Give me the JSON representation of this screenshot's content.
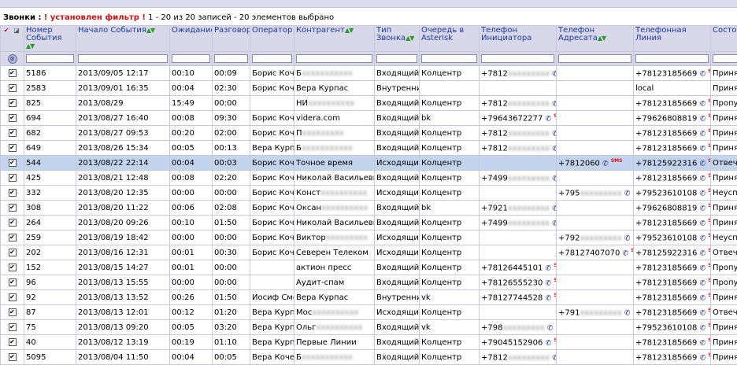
{
  "status": {
    "label": "Звонки :",
    "filter_flag": "! установлен фильтр !",
    "summary": "1 - 20 из 20 записей - 20 элементов выбрано"
  },
  "columns": [
    "Номер События",
    "Начало События",
    "Ожидание",
    "Разговор",
    "Оператор",
    "Контрагент",
    "Тип Звонка",
    "Очередь в Asterisk",
    "Телефон Инициатора",
    "Телефон Адресата",
    "Телефонная Линия",
    "Состояние"
  ],
  "header_icons": {
    "a": "✔",
    "b": "◪",
    "gear": "⚙"
  },
  "phone_icon": "✆",
  "sms_icon": "SMS",
  "check_mark": "✔",
  "rows": [
    {
      "id": "5186",
      "start": "2013/09/05 12:17",
      "wait": "00:10",
      "talk": "00:09",
      "oper": "Борис Кочеров",
      "contr": "Б",
      "contr_b": "xxxxxxxxxxx",
      "type": "Входящий",
      "queue": "Колцентр",
      "init": "+7812",
      "init_b": "xxxxxxxxx",
      "dest": "",
      "dest_b": "",
      "line": "+78123185669",
      "state": "Принят",
      "sel": false
    },
    {
      "id": "2583",
      "start": "2013/09/01 16:35",
      "wait": "00:04",
      "talk": "02:30",
      "oper": "Борис Кочеров",
      "contr": "Вера Курпас",
      "contr_b": "",
      "type": "Внутренний",
      "queue": "",
      "init": "",
      "init_b": "",
      "dest": "",
      "dest_b": "",
      "line": "local",
      "state": "Принят",
      "sel": false
    },
    {
      "id": "825",
      "start": "2013/08/29",
      "wait": "15:49",
      "talk": "00:00",
      "oper": "",
      "contr": "НИ",
      "contr_b": "xxxxxxxxxx",
      "type": "Входящий",
      "queue": "Колцентр",
      "init": "+7812",
      "init_b": "xxxxxxxxx",
      "dest": "",
      "dest_b": "",
      "line": "+78123185669",
      "state": "Пропущен",
      "sel": false
    },
    {
      "id": "694",
      "start": "2013/08/27 16:40",
      "wait": "00:08",
      "talk": "09:30",
      "oper": "Борис Кочеров",
      "contr": "videra.com",
      "contr_b": "",
      "type": "Входящий",
      "queue": "bk",
      "init": "+79643672277",
      "init_b": "",
      "dest": "",
      "dest_b": "",
      "line": "+79626808819",
      "state": "Принят",
      "sel": false
    },
    {
      "id": "682",
      "start": "2013/08/27 09:53",
      "wait": "00:20",
      "talk": "02:00",
      "oper": "Борис Кочеров",
      "contr": "П",
      "contr_b": "xxxxxxxxx",
      "type": "Входящий",
      "queue": "Колцентр",
      "init": "+7812",
      "init_b": "xxxxxxxxx",
      "dest": "",
      "dest_b": "",
      "line": "+78123185669",
      "state": "Принят",
      "sel": false
    },
    {
      "id": "649",
      "start": "2013/08/26 15:34",
      "wait": "00:05",
      "talk": "00:13",
      "oper": "Вера Курпас",
      "contr": "Б",
      "contr_b": "xxxxxxxxxxx",
      "type": "Входящий",
      "queue": "Колцентр",
      "init": "+7812",
      "init_b": "xxxxxxxxx",
      "dest": "",
      "dest_b": "",
      "line": "+78123185669",
      "state": "Принят",
      "sel": false
    },
    {
      "id": "544",
      "start": "2013/08/22 22:14",
      "wait": "00:04",
      "talk": "00:03",
      "oper": "Борис Кочеров",
      "contr": "Точное время",
      "contr_b": "",
      "type": "Исходящий",
      "queue": "Колцентр",
      "init": "",
      "init_b": "",
      "dest": "+7812060",
      "dest_b": "",
      "line": "+78125922316",
      "state": "Отвеченный",
      "sel": true
    },
    {
      "id": "425",
      "start": "2013/08/21 12:48",
      "wait": "00:08",
      "talk": "02:20",
      "oper": "Борис Кочеров",
      "contr": "Николай Васильевич Дмитриев",
      "contr_b": "",
      "type": "Входящий",
      "queue": "Колцентр",
      "init": "+7499",
      "init_b": "xxxxxxxxx",
      "dest": "",
      "dest_b": "",
      "line": "+78123185669",
      "state": "Принят",
      "sel": false
    },
    {
      "id": "332",
      "start": "2013/08/20 12:35",
      "wait": "00:00",
      "talk": "00:00",
      "oper": "Борис Кочеров",
      "contr": "Конст",
      "contr_b": "xxxxxxxxxx",
      "type": "Исходящий",
      "queue": "Колцентр",
      "init": "",
      "init_b": "",
      "dest": "+795",
      "dest_b": "xxxxxxxxx",
      "line": "+79523610108",
      "state": "Неуспешный",
      "sel": false
    },
    {
      "id": "308",
      "start": "2013/08/20 11:22",
      "wait": "00:06",
      "talk": "02:08",
      "oper": "Борис Кочеров",
      "contr": "Оксан",
      "contr_b": "xxxxxxxxxx",
      "type": "Входящий",
      "queue": "bk",
      "init": "+7921",
      "init_b": "xxxxxxxxx",
      "dest": "",
      "dest_b": "",
      "line": "+79626808819",
      "state": "Принят",
      "sel": false
    },
    {
      "id": "264",
      "start": "2013/08/20 09:26",
      "wait": "00:10",
      "talk": "01:50",
      "oper": "Борис Кочеров",
      "contr": "Николай Васильевич Дмитриев",
      "contr_b": "",
      "type": "Входящий",
      "queue": "Колцентр",
      "init": "+7499",
      "init_b": "xxxxxxxxx",
      "dest": "",
      "dest_b": "",
      "line": "+78123185669",
      "state": "Принят",
      "sel": false
    },
    {
      "id": "259",
      "start": "2013/08/19 18:42",
      "wait": "00:00",
      "talk": "00:00",
      "oper": "Борис Кочеров",
      "contr": "Виктор",
      "contr_b": "xxxxxxxxx",
      "type": "Исходящий",
      "queue": "Колцентр",
      "init": "",
      "init_b": "",
      "dest": "+792",
      "dest_b": "xxxxxxxxx",
      "line": "+79523610108",
      "state": "Неуспешный",
      "sel": false
    },
    {
      "id": "202",
      "start": "2013/08/16 12:31",
      "wait": "00:01",
      "talk": "00:30",
      "oper": "Борис Кочеров",
      "contr": "Северен Телеком",
      "contr_b": "",
      "type": "Исходящий",
      "queue": "Колцентр",
      "init": "",
      "init_b": "",
      "dest": "+78127407070",
      "dest_b": "",
      "line": "+78125922316",
      "state": "Отвеченный",
      "sel": false
    },
    {
      "id": "152",
      "start": "2013/08/15 14:27",
      "wait": "00:01",
      "talk": "00:00",
      "oper": "",
      "contr": "актион пресс",
      "contr_b": "",
      "type": "Входящий",
      "queue": "Колцентр",
      "init": "+78126445101",
      "init_b": "",
      "dest": "",
      "dest_b": "",
      "line": "+78123185669",
      "state": "Пропущен",
      "sel": false
    },
    {
      "id": "96",
      "start": "2013/08/13 15:55",
      "wait": "00:00",
      "talk": "00:00",
      "oper": "",
      "contr": "Аудит-спам",
      "contr_b": "",
      "type": "Входящий",
      "queue": "Колцентр",
      "init": "+78126555230",
      "init_b": "",
      "dest": "",
      "dest_b": "",
      "line": "+78123185669",
      "state": "Пропущен",
      "sel": false
    },
    {
      "id": "92",
      "start": "2013/08/13 13:52",
      "wait": "00:26",
      "talk": "01:50",
      "oper": "Иосиф Смоткин",
      "contr": "Вера Курпас",
      "contr_b": "",
      "type": "Внутренний",
      "queue": "vk",
      "init": "+78127744528",
      "init_b": "",
      "dest": "",
      "dest_b": "",
      "line": "+78123185669",
      "state": "Принят",
      "sel": false
    },
    {
      "id": "87",
      "start": "2013/08/13 12:01",
      "wait": "00:12",
      "talk": "01:20",
      "oper": "Вера Курпас",
      "contr": "Мос",
      "contr_b": "xxxxxxxxxx",
      "type": "Исходящий",
      "queue": "Колцентр",
      "init": "",
      "init_b": "",
      "dest": "+791",
      "dest_b": "xxxxxxxxx",
      "line": "+78123185669",
      "state": "Отвеченный",
      "sel": false
    },
    {
      "id": "75",
      "start": "2013/08/13 09:20",
      "wait": "00:05",
      "talk": "03:20",
      "oper": "Вера Курпас",
      "contr": "Ольг",
      "contr_b": "xxxxxxxxxx",
      "type": "Входящий",
      "queue": "vk",
      "init": "+798",
      "init_b": "xxxxxxxxx",
      "dest": "",
      "dest_b": "",
      "line": "+79523610108",
      "state": "Принят",
      "sel": false
    },
    {
      "id": "40",
      "start": "2013/08/12 13:19",
      "wait": "00:19",
      "talk": "01:10",
      "oper": "Вера Курпас",
      "contr": "Первые Линии",
      "contr_b": "",
      "type": "Входящий",
      "queue": "Колцентр",
      "init": "+79045152906",
      "init_b": "",
      "dest": "",
      "dest_b": "",
      "line": "+78123185669",
      "state": "Принят",
      "sel": false
    },
    {
      "id": "5095",
      "start": "2013/08/04 11:50",
      "wait": "00:04",
      "talk": "00:05",
      "oper": "Вера Кочеров",
      "contr": "Б",
      "contr_b": "xxxxxxxxxxx",
      "type": "Входящий",
      "queue": "Колцентр",
      "init": "+7812",
      "init_b": "xxxxxxxxx",
      "dest": "",
      "dest_b": "",
      "line": "+78123185669",
      "state": "Принят",
      "sel": false
    }
  ]
}
